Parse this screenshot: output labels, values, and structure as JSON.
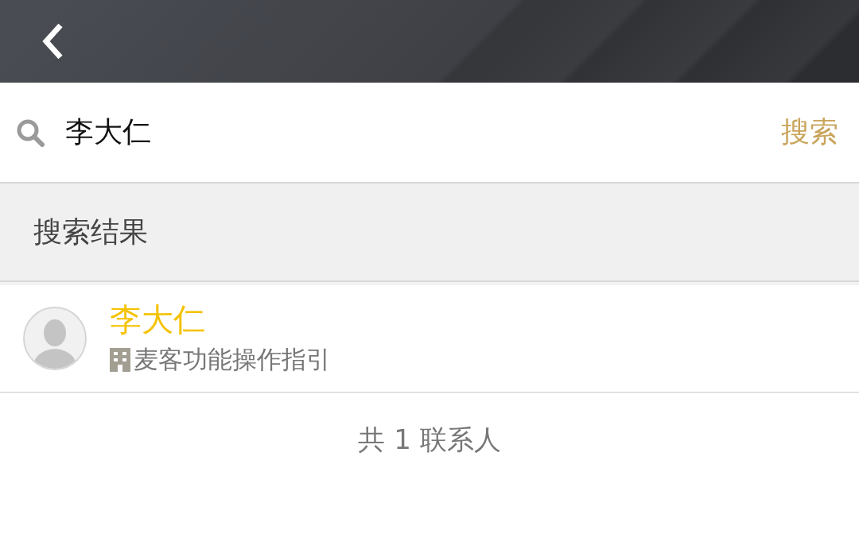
{
  "search": {
    "value": "李大仁",
    "button": "搜索"
  },
  "section": {
    "title": "搜索结果"
  },
  "results": [
    {
      "name": "李大仁",
      "department": "麦客功能操作指引"
    }
  ],
  "footer": {
    "summary": "共 1 联系人"
  }
}
